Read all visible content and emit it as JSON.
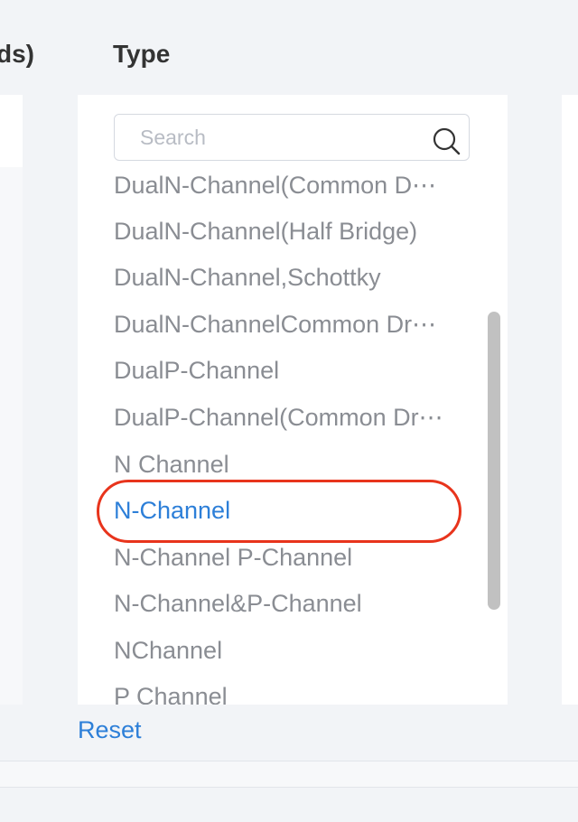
{
  "columns": {
    "left_header_fragment": "ds)",
    "type_header": "Type"
  },
  "search": {
    "placeholder": "Search",
    "value": ""
  },
  "type_list": {
    "items": [
      "DualN-Channel(Common D⋯",
      "DualN-Channel(Half Bridge)",
      "DualN-Channel,Schottky",
      "DualN-ChannelCommon Dr⋯",
      "DualP-Channel",
      "DualP-Channel(Common Dr⋯",
      "N Channel",
      "N-Channel",
      "N-Channel P-Channel",
      "N-Channel&P-Channel",
      "NChannel",
      "P Channel"
    ],
    "selected_index": 7,
    "selected_color": "#2d7fd8",
    "item_color": "#8a8d93",
    "highlight_color": "#e8341c"
  },
  "footer": {
    "reset_label": "Reset"
  },
  "icons": {
    "search": "search-icon"
  }
}
